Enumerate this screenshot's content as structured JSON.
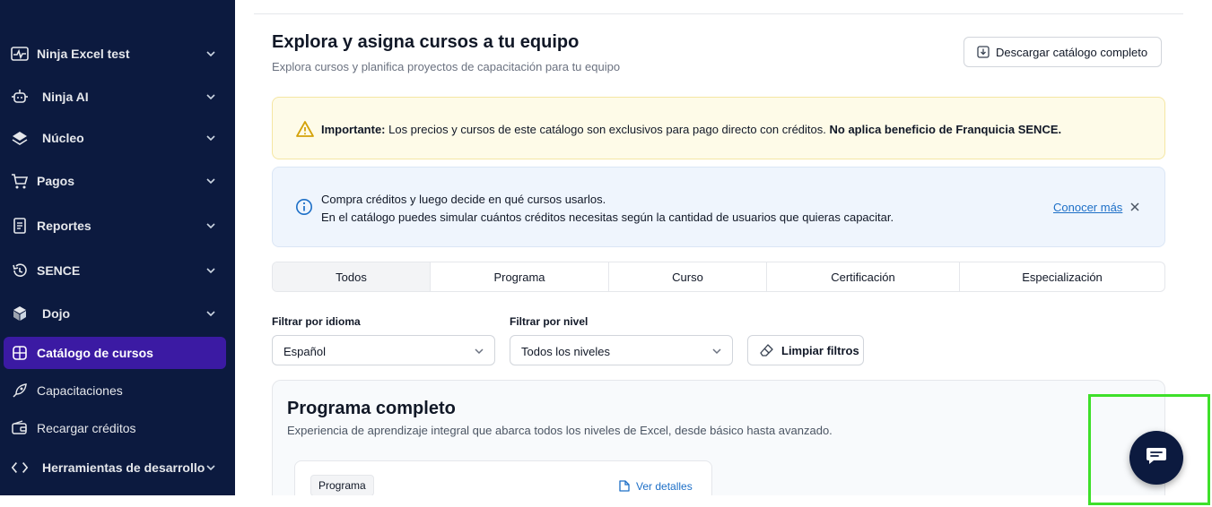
{
  "sidebar": {
    "items": [
      {
        "label": "Ninja Excel test",
        "icon": "pulse-icon",
        "expandable": true
      },
      {
        "label": "Ninja AI",
        "icon": "robot-icon",
        "expandable": true
      },
      {
        "label": "Núcleo",
        "icon": "layers-icon",
        "expandable": true
      },
      {
        "label": "Pagos",
        "icon": "cart-icon",
        "expandable": true
      },
      {
        "label": "Reportes",
        "icon": "report-icon",
        "expandable": true
      },
      {
        "label": "SENCE",
        "icon": "history-icon",
        "expandable": true
      },
      {
        "label": "Dojo",
        "icon": "cube-icon",
        "expandable": true
      },
      {
        "label": "Catálogo de cursos",
        "icon": "catalog-icon",
        "active": true
      },
      {
        "label": "Capacitaciones",
        "icon": "rocket-icon"
      },
      {
        "label": "Recargar créditos",
        "icon": "wallet-icon"
      },
      {
        "label": "Herramientas de desarrollo",
        "icon": "code-icon",
        "expandable": true
      }
    ]
  },
  "header": {
    "title": "Explora y asigna cursos a tu equipo",
    "subtitle": "Explora cursos y planifica proyectos de capacitación para tu equipo",
    "download_label": "Descargar catálogo completo"
  },
  "warning": {
    "strong": "Importante:",
    "text": " Los precios y cursos de este catálogo son exclusivos para pago directo con créditos. ",
    "emphasis": "No aplica beneficio de Franquicia SENCE."
  },
  "info": {
    "line1": "Compra créditos y luego decide en qué cursos usarlos.",
    "line2": "En el catálogo puedes simular cuántos créditos necesitas según la cantidad de usuarios que quieras capacitar.",
    "link": "Conocer más"
  },
  "tabs": [
    "Todos",
    "Programa",
    "Curso",
    "Certificación",
    "Especialización"
  ],
  "filters": {
    "language_label": "Filtrar por idioma",
    "language_value": "Español",
    "level_label": "Filtrar por nivel",
    "level_value": "Todos los niveles",
    "clear_label": "Limpiar filtros"
  },
  "section": {
    "title": "Programa completo",
    "subtitle": "Experiencia de aprendizaje integral que abarca todos los niveles de Excel, desde básico hasta avanzado.",
    "card_badge": "Programa",
    "card_link": "Ver detalles"
  },
  "colors": {
    "sidebar_bg": "#0c1a3f",
    "active_item": "#3b1aa3",
    "link": "#1d6fc7",
    "warning_bg": "#fefbe8",
    "info_bg": "#eff5fd",
    "highlight": "#3ee02a"
  }
}
